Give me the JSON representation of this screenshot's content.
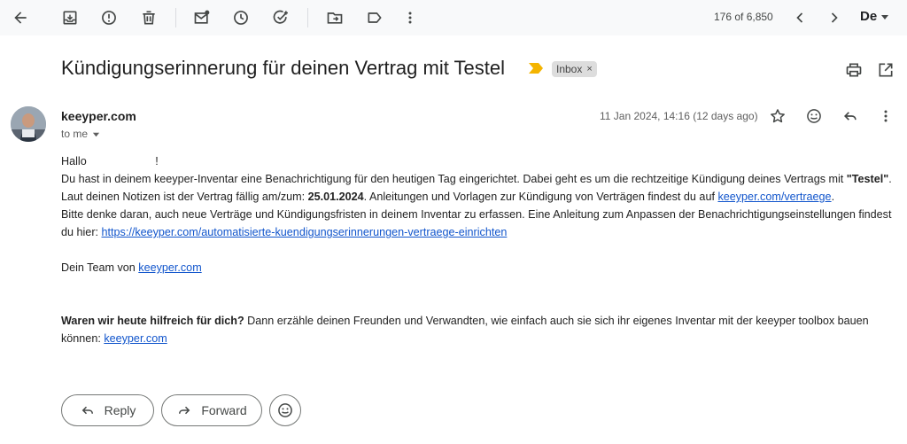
{
  "toolbar": {
    "icons": [
      "back-arrow-icon",
      "archive-icon",
      "report-spam-icon",
      "delete-icon",
      "mark-unread-icon",
      "snooze-icon",
      "add-to-tasks-icon",
      "move-to-icon",
      "label-icon",
      "more-icon"
    ],
    "counter": "176 of 6,850",
    "language": "De"
  },
  "email": {
    "subject": "Kündigungserinnerung für deinen Vertrag mit Testel",
    "label_chip": "Inbox",
    "label_chip_close": "×",
    "sender": "keeyper.com",
    "recipient": "to me",
    "date": "11 Jan 2024, 14:16 (12 days ago)",
    "body": {
      "greeting_start": "Hallo",
      "greeting_end": "!",
      "p1_a": "Du hast in deinem keeyper-Inventar eine Benachrichtigung für den heutigen Tag eingerichtet. Dabei geht es um die rechtzeitige Kündigung deines Vertrags mit ",
      "p1_contract": "\"Testel\"",
      "p1_b": ". Laut deinen Notizen ist der Vertrag fällig am/zum: ",
      "p1_date": "25.01.2024",
      "p1_c": ". Anleitungen und Vorlagen zur Kündigung von Verträgen findest du auf ",
      "p1_link": "keeyper.com/vertraege",
      "p1_d": ".",
      "p2_a": "Bitte denke daran, auch neue Verträge und Kündigungsfristen in deinem Inventar zu erfassen. Eine Anleitung zum Anpassen der Benachrichtigungseinstellungen findest du hier: ",
      "p2_link": "https://keeyper.com/automatisierte-kuendigungserinnerungen-vertraege-einrichten",
      "signoff": "Dein Team von ",
      "signoff_link": "keeyper.com",
      "footer_bold": "Waren wir heute hilfreich für dich?",
      "footer_text": " Dann erzähle deinen Freunden und Verwandten, wie einfach auch sie sich ihr eigenes Inventar mit der keeyper toolbox bauen können: ",
      "footer_link": "keeyper.com"
    }
  },
  "actions": {
    "reply": "Reply",
    "forward": "Forward"
  },
  "colors": {
    "link": "#1155cc",
    "important_marker": "#f4b400",
    "toolbar_bg": "#f8f9fa"
  }
}
